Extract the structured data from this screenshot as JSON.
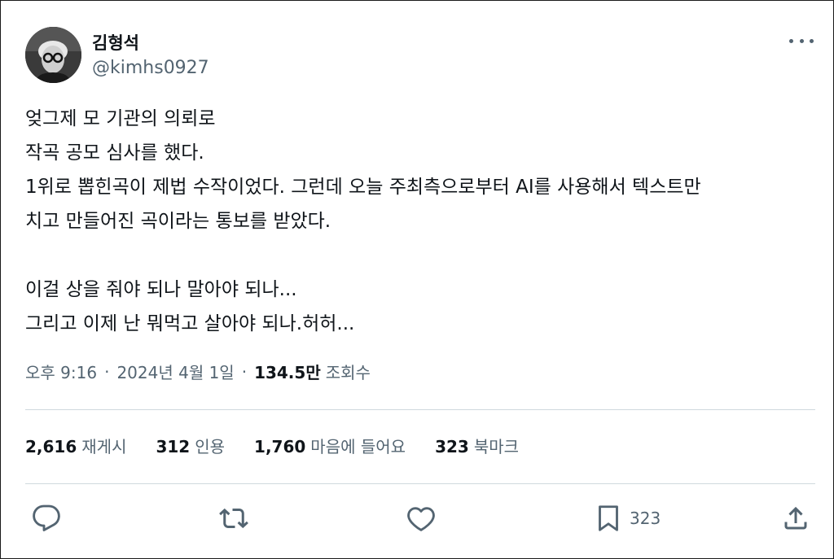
{
  "author": {
    "name": "김형석",
    "handle": "@kimhs0927"
  },
  "tweet": {
    "lines": [
      "엊그제 모 기관의 의뢰로",
      "작곡 공모 심사를 했다.",
      "1위로 뽑힌곡이 제법 수작이었다. 그런데 오늘 주최측으로부터 AI를 사용해서 텍스트만",
      "치고 만들어진 곡이라는 통보를 받았다.",
      "",
      "이걸 상을 줘야 되나 말아야 되나...",
      "그리고 이제 난 뭐먹고 살아야 되나.허허..."
    ]
  },
  "meta": {
    "time": "오후 9:16",
    "separator": "·",
    "date": "2024년 4월 1일",
    "views_count": "134.5만",
    "views_label": "조회수"
  },
  "stats": [
    {
      "count": "2,616",
      "label": "재게시"
    },
    {
      "count": "312",
      "label": "인용"
    },
    {
      "count": "1,760",
      "label": "마음에 들어요"
    },
    {
      "count": "323",
      "label": "북마크"
    }
  ],
  "actions": {
    "bookmark_count": "323"
  },
  "icons": {
    "more": "more-horizontal-icon",
    "reply": "reply-icon",
    "retweet": "retweet-icon",
    "like": "heart-icon",
    "bookmark": "bookmark-icon",
    "share": "share-icon"
  },
  "colors": {
    "text": "#0f1419",
    "secondary": "#536471",
    "divider": "#cfd9de"
  }
}
